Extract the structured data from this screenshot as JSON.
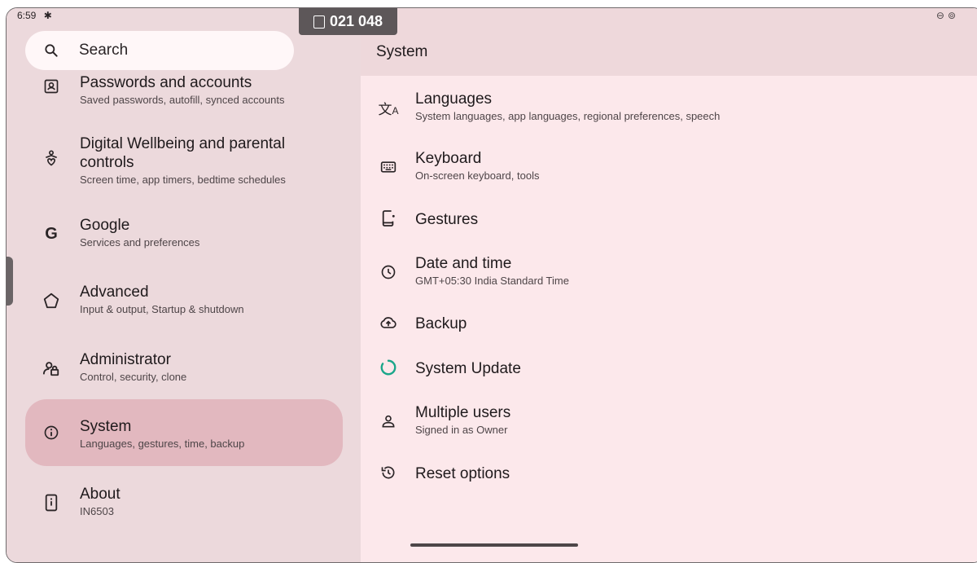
{
  "status": {
    "time": "6:59",
    "settings_icon": "gear-icon",
    "right_icons": [
      "do-not-disturb-icon",
      "hotspot-icon"
    ]
  },
  "notification_pill": {
    "icon": "message-icon",
    "text": "021 048"
  },
  "search": {
    "placeholder": "Search",
    "icon": "search-icon"
  },
  "sidebar": {
    "items": [
      {
        "title": "Passwords and accounts",
        "subtitle": "Saved passwords, autofill, synced accounts",
        "icon": "account-box-icon"
      },
      {
        "title": "Digital Wellbeing and parental",
        "title_line2": "controls",
        "subtitle": "Screen time, app timers, bedtime schedules",
        "icon": "wellbeing-icon"
      },
      {
        "title": "Google",
        "subtitle": "Services and preferences",
        "icon": "google-icon"
      },
      {
        "title": "Advanced",
        "subtitle": "Input & output, Startup & shutdown",
        "icon": "advanced-icon"
      },
      {
        "title": "Administrator",
        "subtitle": "Control, security, clone",
        "icon": "admin-icon"
      },
      {
        "title": "System",
        "subtitle": "Languages, gestures, time, backup",
        "icon": "info-icon",
        "selected": true
      },
      {
        "title": "About",
        "subtitle": "IN6503",
        "icon": "about-device-icon"
      }
    ]
  },
  "main": {
    "title": "System",
    "items": [
      {
        "title": "Languages",
        "subtitle": "System languages, app languages, regional preferences, speech",
        "icon": "translate-icon"
      },
      {
        "title": "Keyboard",
        "subtitle": "On-screen keyboard, tools",
        "icon": "keyboard-icon"
      },
      {
        "title": "Gestures",
        "subtitle": "",
        "icon": "gestures-icon"
      },
      {
        "title": "Date and time",
        "subtitle": "GMT+05:30 India Standard Time",
        "icon": "clock-icon"
      },
      {
        "title": "Backup",
        "subtitle": "",
        "icon": "cloud-upload-icon"
      },
      {
        "title": "System Update",
        "subtitle": "",
        "icon": "update-icon"
      },
      {
        "title": "Multiple users",
        "subtitle": "Signed in as Owner",
        "icon": "person-icon"
      },
      {
        "title": "Reset options",
        "subtitle": "",
        "icon": "history-icon"
      }
    ]
  },
  "colors": {
    "accent_update": "#1aa68a",
    "selected_bg": "#e2b8bf",
    "left_bg": "#ecd9dc",
    "right_bg": "#fce8eb"
  }
}
